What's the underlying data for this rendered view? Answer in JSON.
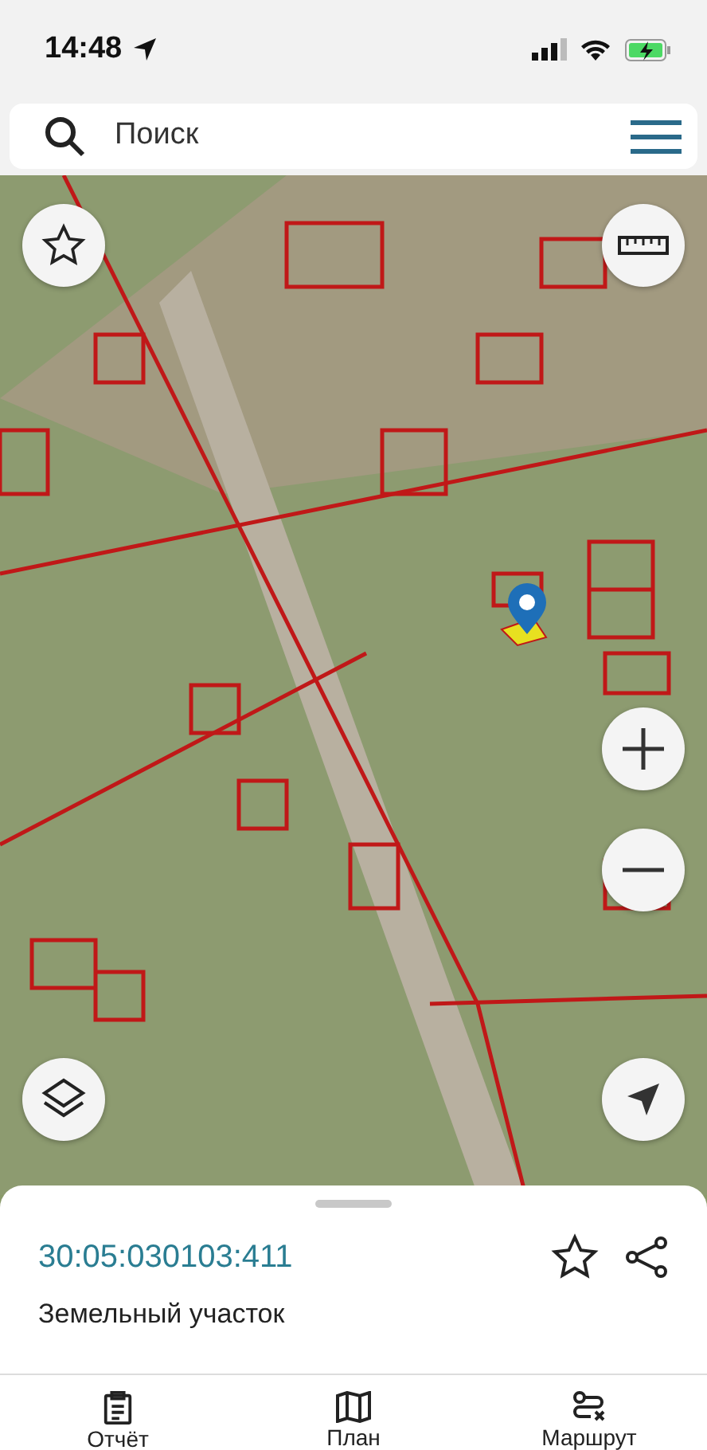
{
  "status_bar": {
    "time": "14:48"
  },
  "search": {
    "placeholder": "Поиск"
  },
  "parcel": {
    "number": "30:05:030103:411",
    "type": "Земельный участок"
  },
  "bottom_tabs": [
    {
      "label": "Отчёт",
      "kind": "report"
    },
    {
      "label": "План",
      "kind": "plan"
    },
    {
      "label": "Маршрут",
      "kind": "route"
    }
  ]
}
